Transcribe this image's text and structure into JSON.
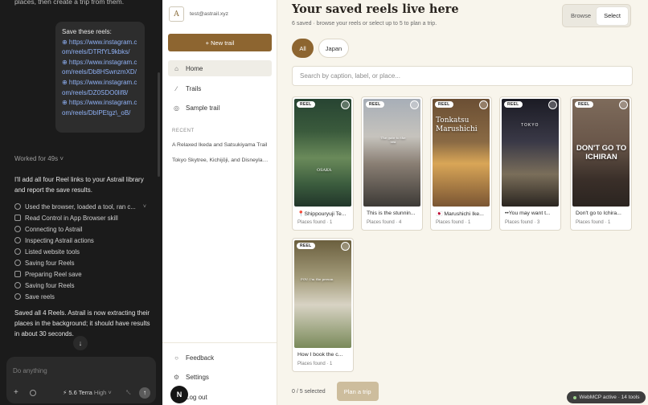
{
  "chat": {
    "top_text": "places, then create a trip from them.",
    "bubble_title": "Save these reels:",
    "links": [
      "⊕ https://www.instagram.com/reels/DTRfYL9kbks/",
      "⊕ https://www.instagram.com/reels/Db8HSwnzmXD/",
      "⊕ https://www.instagram.com/reels/DZ0SDO0lif8/",
      "⊕ https://www.instagram.com/reels/DbIPEtgz\\_oB/"
    ],
    "worked": "Worked for 49s ˅",
    "reply": "I'll add all four Reel links to your Astrail library and report the save results.",
    "steps": [
      {
        "label": "Used the browser, loaded a tool, ran c...",
        "icon": "globe-icon",
        "chev": "˅"
      },
      {
        "label": "Read Control in App Browser skill",
        "icon": "document-icon",
        "chev": ""
      },
      {
        "label": "Connecting to Astrail",
        "icon": "globe-icon",
        "chev": ""
      },
      {
        "label": "Inspecting Astrail actions",
        "icon": "globe-icon",
        "chev": ""
      },
      {
        "label": "Listed website tools",
        "icon": "globe-icon",
        "chev": ""
      },
      {
        "label": "Saving four Reels",
        "icon": "globe-icon",
        "chev": ""
      },
      {
        "label": "Preparing Reel save",
        "icon": "document-icon",
        "chev": ""
      },
      {
        "label": "Saving four Reels",
        "icon": "globe-icon",
        "chev": ""
      },
      {
        "label": "Save reels",
        "icon": "globe-icon",
        "chev": ""
      }
    ],
    "saved": "Saved all 4 Reels. Astrail is now extracting their places in the background; it should have results in about 30 seconds.",
    "scroll_down": "↓",
    "composer": {
      "placeholder": "Do anything",
      "plus": "+",
      "model": "⚡ 5.6 Terra",
      "level": "High ˅",
      "mic": "␇",
      "send": "↑"
    }
  },
  "sidebar": {
    "avatar": "A",
    "email": "test@astrail.xyz",
    "new_trail": "+  New trail",
    "nav": [
      {
        "label": "Home",
        "icon": "⌂"
      },
      {
        "label": "Trails",
        "icon": "∕"
      },
      {
        "label": "Sample trail",
        "icon": "◎"
      }
    ],
    "recent_heading": "RECENT",
    "recent": [
      "A Relaxed Ikeda and Satsukiyama Trail",
      "Tokyo Skytree, Kichijōji, and Disneyland"
    ],
    "feedback": "Feedback",
    "feedback_icon": "○",
    "settings": "Settings",
    "settings_icon": "⚙",
    "logout": "Log out",
    "badge": "N"
  },
  "main": {
    "title": "Your saved reels live here",
    "subtitle": "6 saved · browse your reels or select up to 5 to plan a trip.",
    "toggle": [
      "Browse",
      "Select"
    ],
    "filters": [
      "All",
      "Japan"
    ],
    "search_placeholder": "Search by caption, label, or place...",
    "tag": "REEL",
    "cards": [
      {
        "caption": "📍Shippouryuji Te...",
        "places": "Places found · 1",
        "overlay": "OSAKA"
      },
      {
        "caption": "This is the stunnin...",
        "places": "Places found · 4",
        "overlay": "The gate to the sea"
      },
      {
        "caption": "🇯🇵 Marushichi Ike...",
        "places": "Places found · 1",
        "overlay": "Tonkatsu Marushichi"
      },
      {
        "caption": "••You may want t...",
        "places": "Places found · 3",
        "overlay": "TOKYO"
      },
      {
        "caption": "Don't go to Ichira...",
        "places": "Places found · 1",
        "overlay": "DON'T GO TO ICHIRAN"
      },
      {
        "caption": "How I book the c...",
        "places": "Places found · 1",
        "overlay": "POV: I'm the person"
      }
    ],
    "selected_count": "0 / 5 selected",
    "plan_button": "Plan a trip"
  },
  "webmcp": "WebMCP active · 14 tools",
  "colors": {
    "accent": "#8d6530",
    "page_bg": "#f8f5ec",
    "chat_bg": "#1b1b1b"
  }
}
